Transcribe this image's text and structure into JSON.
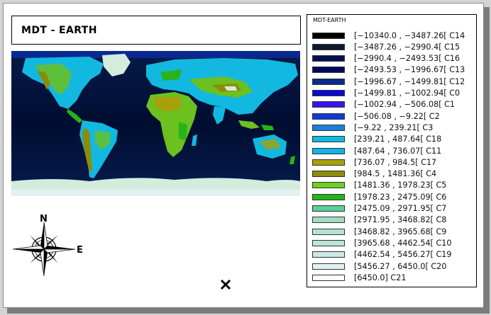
{
  "title": "MDT - EARTH",
  "legend": {
    "title": "MDT-EARTH",
    "items": [
      {
        "label": "[−10340.0 , −3487.26[ C14",
        "color": "#000000"
      },
      {
        "label": "[−3487.26 , −2990.4[ C15",
        "color": "#0d1a2d"
      },
      {
        "label": "[−2990.4 , −2493.53[ C16",
        "color": "#001050"
      },
      {
        "label": "[−2493.53 , −1996.67[ C13",
        "color": "#000a5e"
      },
      {
        "label": "[−1996.67 , −1499.81[ C12",
        "color": "#0b2c8a"
      },
      {
        "label": "[−1499.81 , −1002.94[ C0",
        "color": "#0a0ad0"
      },
      {
        "label": "[−1002.94 , −506.08[ C1",
        "color": "#3a14f0"
      },
      {
        "label": "[−506.08 , −9.22[ C2",
        "color": "#0e3ad8"
      },
      {
        "label": "[−9.22 , 239.21[ C3",
        "color": "#1a80e0"
      },
      {
        "label": "[239.21 , 487.64[ C18",
        "color": "#12b8e0"
      },
      {
        "label": "[487.64 , 736.07[ C11",
        "color": "#10b4e8"
      },
      {
        "label": "[736.07 , 984.5[ C17",
        "color": "#a8a00a"
      },
      {
        "label": "[984.5 , 1481.36[ C4",
        "color": "#8c8c0c"
      },
      {
        "label": "[1481.36 , 1978.23[ C5",
        "color": "#6cd020"
      },
      {
        "label": "[1978.23 , 2475.09[ C6",
        "color": "#28b418"
      },
      {
        "label": "[2475.09 , 2971.95[ C7",
        "color": "#58d098"
      },
      {
        "label": "[2971.95 , 3468.82[ C8",
        "color": "#a0dcc0"
      },
      {
        "label": "[3468.82 , 3965.68[ C9",
        "color": "#b4e4d0"
      },
      {
        "label": "[3965.68 , 4462.54[ C10",
        "color": "#bce6d8"
      },
      {
        "label": "[4462.54 , 5456.27[ C19",
        "color": "#cce8e8"
      },
      {
        "label": "[5456.27 , 6450.0[ C20",
        "color": "#e4f0f4"
      },
      {
        "label": "[6450.0] C21",
        "color": "#ffffff"
      }
    ]
  },
  "north_arrow": {
    "north_label": "N",
    "east_label": "E"
  },
  "colors": {
    "ocean_deep": "#000818",
    "ocean": "#051a5a",
    "shelf": "#1a7fe0",
    "lowland": "#12b8e0",
    "upland": "#6cc020",
    "mountain": "#8c8c0c",
    "ice": "#d4ecdc"
  }
}
